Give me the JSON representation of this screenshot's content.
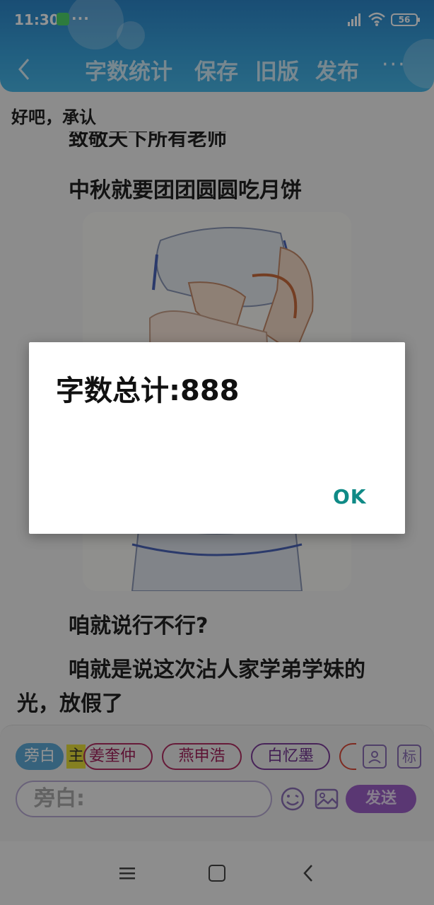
{
  "status_bar": {
    "time": "11:30",
    "more_dots": "···",
    "battery": "56"
  },
  "toolbar": {
    "word_count_label": "字数统计",
    "save_label": "保存",
    "old_version_label": "旧版",
    "publish_label": "发布",
    "more_label": "···"
  },
  "content": {
    "pinned_text": "好吧，承认",
    "partial_line": "致敬天下所有老师",
    "line_mid_autumn": "中秋就要团团圆圆吃月饼",
    "line_1": "咱就说行不行?",
    "line_2a": "咱就是说这次沾人家学弟学妹的",
    "line_2b": "光，放假了"
  },
  "input_area": {
    "narrator_chip": "旁白",
    "main_mark": "主",
    "roles": [
      "姜奎仲",
      "燕申浩",
      "白忆墨"
    ],
    "tag_icon_label": "标",
    "input_value": "旁白:",
    "send_label": "发送"
  },
  "dialog": {
    "message": "字数总计:888",
    "ok_label": "OK"
  },
  "colors": {
    "header": "#3aa4dd",
    "dialog_ok": "#0f8a86",
    "send": "#9b5fc7"
  }
}
